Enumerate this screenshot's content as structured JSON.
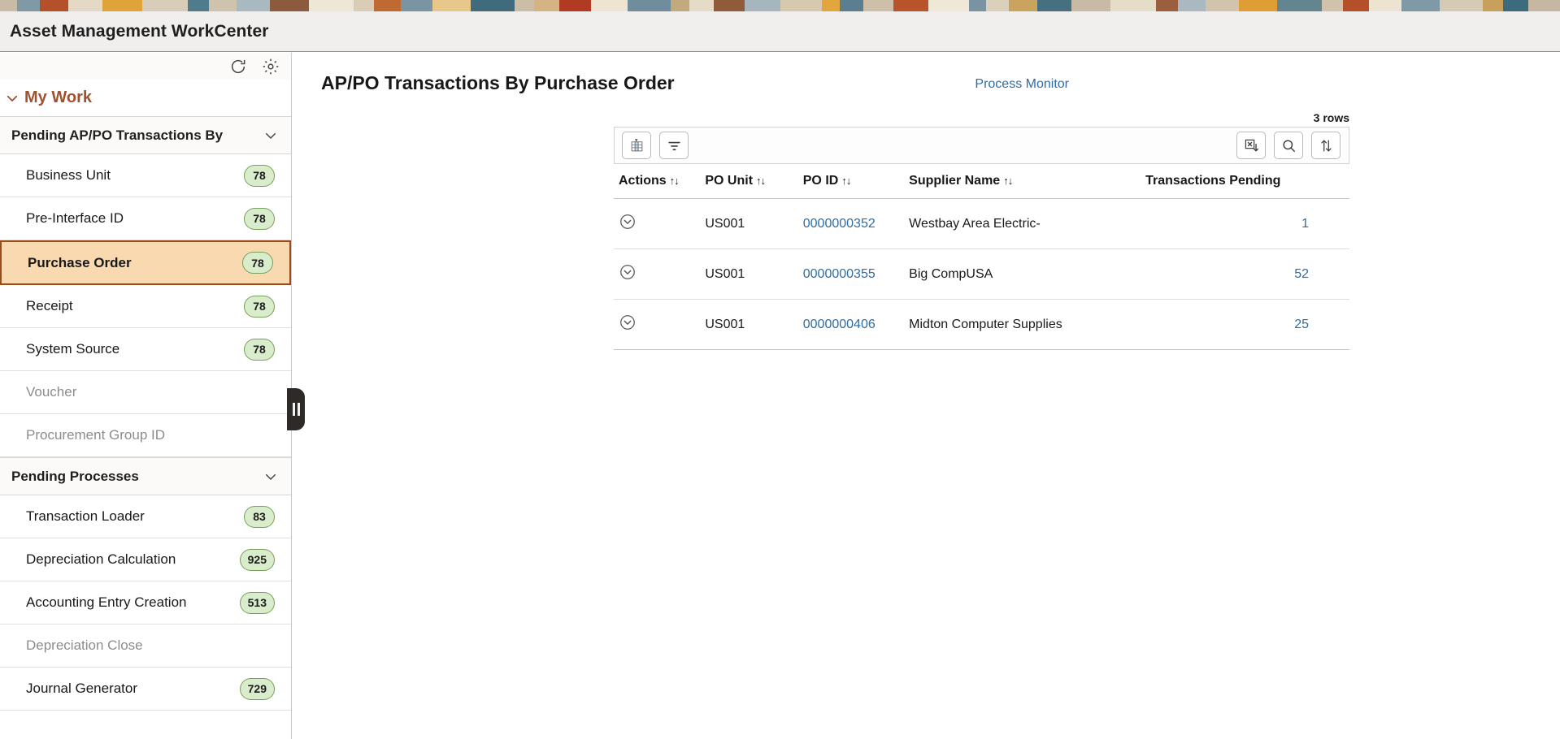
{
  "app": {
    "title": "Asset Management WorkCenter"
  },
  "decor_band": {
    "colors": [
      "#c9bba6",
      "#7f99a6",
      "#b4512a",
      "#e3d9c6",
      "#e0a33a",
      "#d8cdb8",
      "#4f7b8c",
      "#cfc3ad",
      "#a8b9c2",
      "#8c5a3c",
      "#efe7d6",
      "#d9cdb6",
      "#c06a33",
      "#7b94a3",
      "#e8c88a",
      "#3f6b7d",
      "#cbbda6",
      "#d4b483",
      "#b03a22",
      "#ede5d2",
      "#6f8d9c",
      "#c2a97e",
      "#e5dcc8",
      "#8f5b3a",
      "#a6b6bf",
      "#d7c9b0",
      "#e2a63c",
      "#5a7f90",
      "#cdbfa8",
      "#b8532c",
      "#f0e8d7",
      "#7a93a2",
      "#dbd0ba",
      "#caa35f",
      "#46707f",
      "#c8baa4",
      "#e6ddc9",
      "#9c5f3d",
      "#aab9c1",
      "#d2c4ac",
      "#de9e34",
      "#638590",
      "#d0c2ab",
      "#b54f29",
      "#ece4d1",
      "#8099a7",
      "#d6cab4",
      "#c7a05c",
      "#3d6a7c",
      "#c5b7a1"
    ]
  },
  "sidebar": {
    "tools": {
      "refresh_icon": "refresh-icon",
      "settings_icon": "gear-icon"
    },
    "my_work": {
      "label": "My Work",
      "chevron": "chevron-down-icon"
    },
    "sections": [
      {
        "label": "Pending AP/PO Transactions By",
        "chevron": "chevron-down-icon",
        "items": [
          {
            "label": "Business Unit",
            "badge": "78",
            "disabled": false,
            "selected": false
          },
          {
            "label": "Pre-Interface ID",
            "badge": "78",
            "disabled": false,
            "selected": false
          },
          {
            "label": "Purchase Order",
            "badge": "78",
            "disabled": false,
            "selected": true
          },
          {
            "label": "Receipt",
            "badge": "78",
            "disabled": false,
            "selected": false
          },
          {
            "label": "System Source",
            "badge": "78",
            "disabled": false,
            "selected": false
          },
          {
            "label": "Voucher",
            "badge": "",
            "disabled": true,
            "selected": false
          },
          {
            "label": "Procurement Group ID",
            "badge": "",
            "disabled": true,
            "selected": false
          }
        ]
      },
      {
        "label": "Pending Processes",
        "chevron": "chevron-down-icon",
        "items": [
          {
            "label": "Transaction Loader",
            "badge": "83",
            "disabled": false,
            "selected": false
          },
          {
            "label": "Depreciation Calculation",
            "badge": "925",
            "disabled": false,
            "selected": false
          },
          {
            "label": "Accounting Entry Creation",
            "badge": "513",
            "disabled": false,
            "selected": false
          },
          {
            "label": "Depreciation Close",
            "badge": "",
            "disabled": true,
            "selected": false
          },
          {
            "label": "Journal Generator",
            "badge": "729",
            "disabled": false,
            "selected": false
          }
        ]
      }
    ],
    "collapse_handle": "collapse-sidebar-handle"
  },
  "main": {
    "page_title": "AP/PO Transactions By Purchase Order",
    "process_monitor_label": "Process Monitor",
    "rows_count_label": "3 rows",
    "toolbar": {
      "left": [
        {
          "name": "personalize-grid-icon",
          "title": "Personalize"
        },
        {
          "name": "filter-icon",
          "title": "Filter"
        }
      ],
      "right": [
        {
          "name": "export-to-excel-icon",
          "title": "Download to Excel"
        },
        {
          "name": "search-icon",
          "title": "Find"
        },
        {
          "name": "sort-icon",
          "title": "Sort"
        }
      ]
    },
    "grid": {
      "columns": [
        {
          "label": "Actions",
          "sortable": true,
          "sort_indicator": "↑↓"
        },
        {
          "label": "PO Unit",
          "sortable": true,
          "sort_indicator": "↑↓"
        },
        {
          "label": "PO ID",
          "sortable": true,
          "sort_indicator": "↑↓"
        },
        {
          "label": "Supplier Name",
          "sortable": true,
          "sort_indicator": "↑↓"
        },
        {
          "label": "Transactions Pending",
          "sortable": false,
          "sort_indicator": ""
        }
      ],
      "rows": [
        {
          "action_icon": "row-action-chevron-icon",
          "po_unit": "US001",
          "po_id": "0000000352",
          "supplier_name": "Westbay Area Electric-",
          "transactions_pending": "1"
        },
        {
          "action_icon": "row-action-chevron-icon",
          "po_unit": "US001",
          "po_id": "0000000355",
          "supplier_name": "Big CompUSA",
          "transactions_pending": "52"
        },
        {
          "action_icon": "row-action-chevron-icon",
          "po_unit": "US001",
          "po_id": "0000000406",
          "supplier_name": "Midton Computer Supplies",
          "transactions_pending": "25"
        }
      ]
    }
  },
  "colors": {
    "accent_brown": "#a0522d",
    "selected_bg": "#f8d9b0",
    "selected_border": "#9c4a1a",
    "badge_bg": "#d9eccb",
    "badge_border": "#77a05a",
    "link_blue": "#2e6ca4",
    "header_bg": "#f0efed"
  }
}
